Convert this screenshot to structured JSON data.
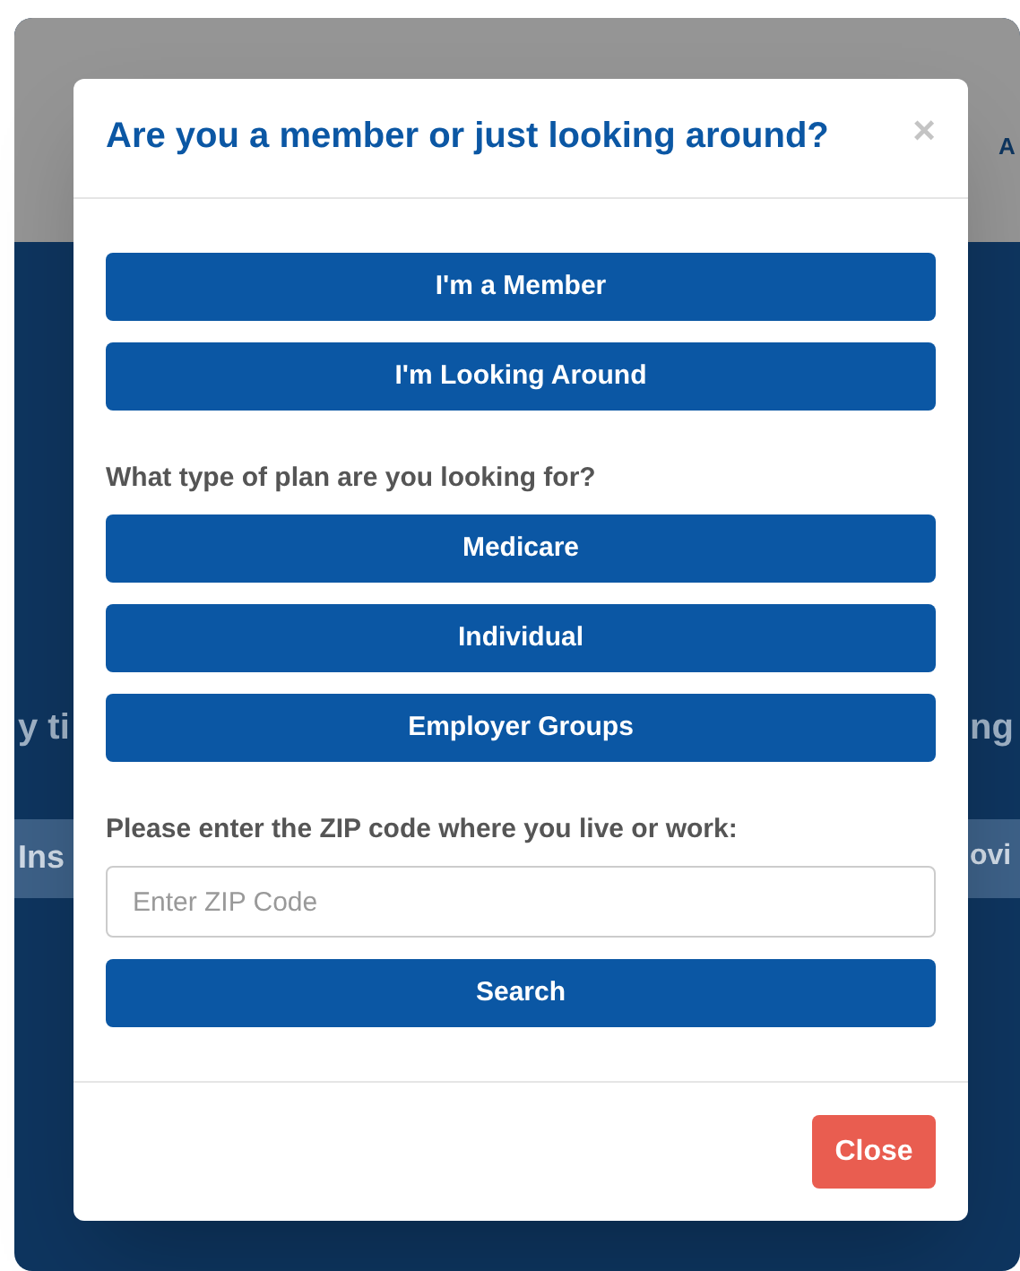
{
  "background": {
    "header_text": "A",
    "left_texts": [
      "y ti",
      "Ins"
    ],
    "right_texts": [
      "ng",
      "ovi"
    ]
  },
  "modal": {
    "title": "Are you a member or just looking around?",
    "close_icon": "×",
    "member_buttons": [
      "I'm a Member",
      "I'm Looking Around"
    ],
    "plan_question": "What type of plan are you looking for?",
    "plan_buttons": [
      "Medicare",
      "Individual",
      "Employer Groups"
    ],
    "zip_label": "Please enter the ZIP code where you live or work:",
    "zip_field": {
      "placeholder": "Enter ZIP Code"
    },
    "search_button": "Search",
    "footer_button": "Close"
  }
}
